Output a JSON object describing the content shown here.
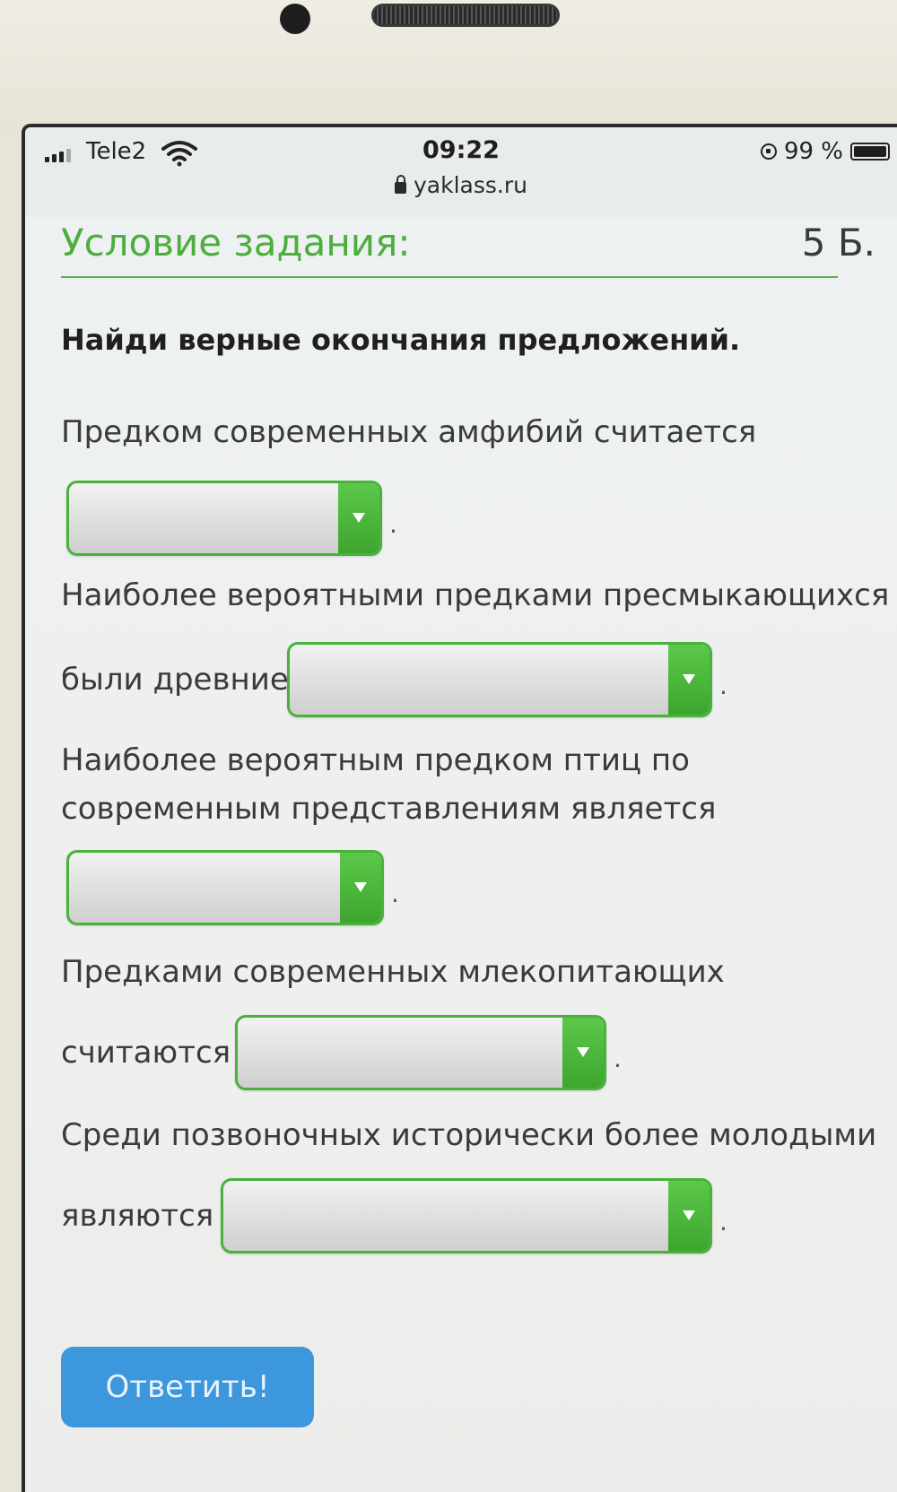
{
  "status_bar": {
    "carrier": "Tele2",
    "time": "09:22",
    "url": "yaklass.ru",
    "battery": "99 %"
  },
  "task": {
    "title": "Условие задания:",
    "points": "5 Б.",
    "instruction": "Найди верные окончания предложений.",
    "questions": [
      {
        "lines": [
          "Предком современных амфибий считается"
        ],
        "selected": "",
        "end": "."
      },
      {
        "lines": [
          "Наиболее вероятными предками пресмыкающихся",
          "были древние"
        ],
        "selected": "",
        "end": "."
      },
      {
        "lines": [
          "Наиболее вероятным предком птиц по",
          "современным представлениям является"
        ],
        "selected": "",
        "end": "."
      },
      {
        "lines": [
          "Предками современных млекопитающих",
          "считаются"
        ],
        "selected": "",
        "end": "."
      },
      {
        "lines": [
          "Среди позвоночных исторически более молодыми",
          "являются"
        ],
        "selected": "",
        "end": "."
      }
    ],
    "submit_label": "Ответить!"
  },
  "colors": {
    "accent_green": "#4cae3d",
    "button_blue": "#3c97dc"
  }
}
